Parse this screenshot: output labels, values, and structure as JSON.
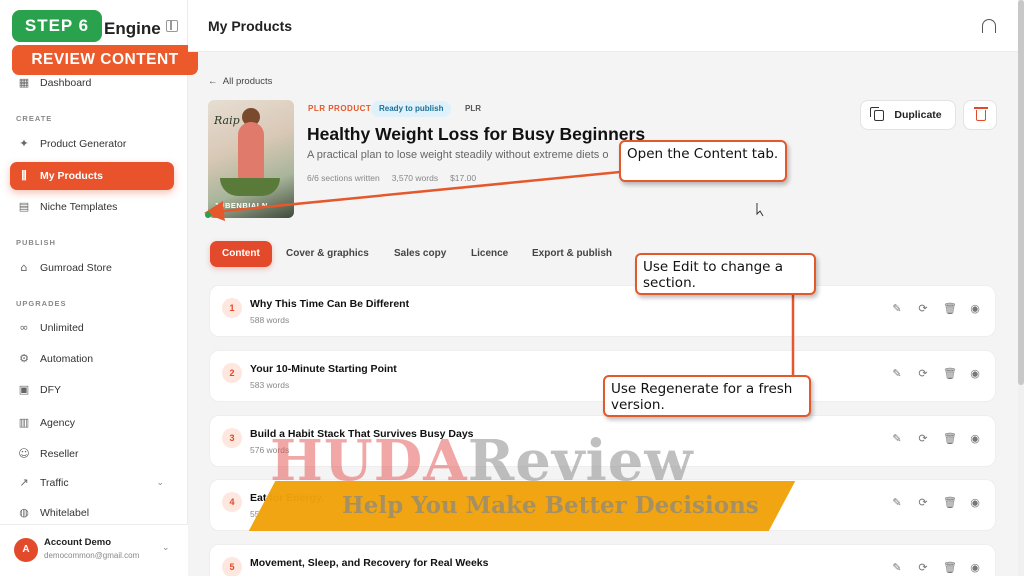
{
  "brand": {
    "name_visible": "Engine"
  },
  "overlay": {
    "step": "STEP 6",
    "step_title": "REVIEW CONTENT"
  },
  "sidebar": {
    "dashboard": "Dashboard",
    "section_create": "CREATE",
    "product_generator": "Product Generator",
    "my_products": "My Products",
    "niche_templates": "Niche Templates",
    "section_publish": "PUBLISH",
    "gumroad_store": "Gumroad Store",
    "section_upgrades": "UPGRADES",
    "unlimited": "Unlimited",
    "automation": "Automation",
    "dfy": "DFY",
    "agency": "Agency",
    "reseller": "Reseller",
    "traffic": "Traffic",
    "whitelabel": "Whitelabel"
  },
  "account": {
    "initial": "A",
    "name": "Account Demo",
    "email": "democommon@gmail.com"
  },
  "header": {
    "title": "My Products"
  },
  "back_link": "All products",
  "product": {
    "cover_script": "Raip",
    "cover_title": "JOBENBIALN",
    "type_tag": "PLR PRODUCT",
    "status": "Ready to publish",
    "licence_tag": "PLR",
    "title": "Healthy Weight Loss for Busy Beginners",
    "subtitle": "A practical plan to lose weight steadily without extreme diets o",
    "sections_written": "6/6 sections written",
    "word_count": "3,570 words",
    "price": "$17.00"
  },
  "actions": {
    "duplicate": "Duplicate"
  },
  "tabs": [
    "Content",
    "Cover & graphics",
    "Sales copy",
    "Licence",
    "Export & publish"
  ],
  "sections": [
    {
      "num": "1",
      "title": "Why This Time Can Be Different",
      "words": "588 words"
    },
    {
      "num": "2",
      "title": "Your 10-Minute Starting Point",
      "words": "583 words"
    },
    {
      "num": "3",
      "title": "Build a Habit Stack That Survives Busy Days",
      "words": "576 words"
    },
    {
      "num": "4",
      "title": "Eat for Energy,",
      "words": "55"
    },
    {
      "num": "5",
      "title": "Movement, Sleep, and Recovery for Real Weeks",
      "words": ""
    }
  ],
  "callouts": {
    "content_tab": "Open the Content tab.",
    "edit": "Use Edit to change a section.",
    "regenerate": "Use Regenerate for a fresh version."
  },
  "watermark": {
    "main_a": "HUDA",
    "main_b": "Review",
    "tagline": "Help You Make Better Decisions"
  },
  "colors": {
    "accent": "#e24a2b",
    "step_green": "#2aa14c",
    "callout_border": "#e4582c"
  }
}
